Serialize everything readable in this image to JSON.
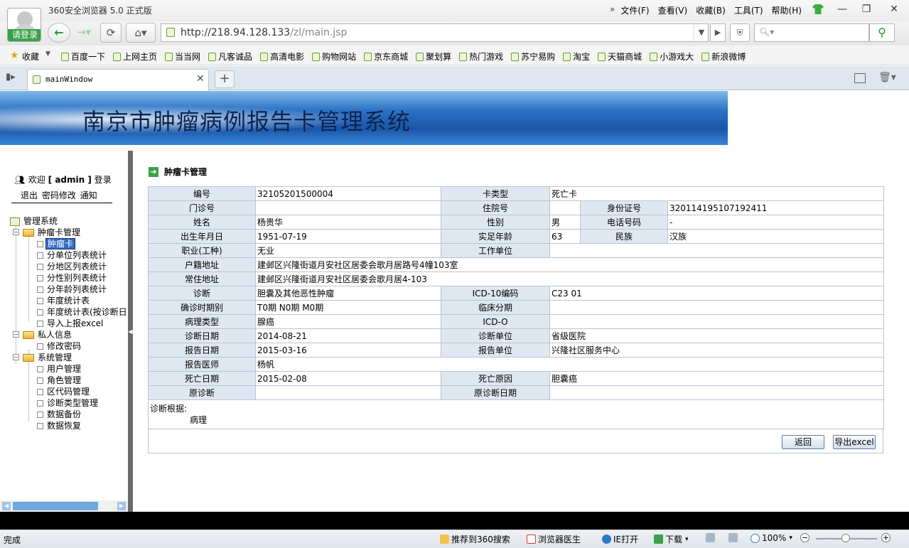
{
  "browser": {
    "title": "360安全浏览器 5.0 正式版",
    "login_label": "请登录",
    "menu": [
      "文件(F)",
      "查看(V)",
      "收藏(B)",
      "工具(T)",
      "帮助(H)"
    ],
    "url_host": "http://218.94.128.133",
    "url_path": "/zl/main.jsp",
    "search_placeholder": "",
    "favorites_label": "收藏",
    "favorites": [
      "百度一下",
      "上网主页",
      "当当网",
      "凡客诚品",
      "高清电影",
      "购物网站",
      "京东商城",
      "聚划算",
      "热门游戏",
      "苏宁易购",
      "淘宝",
      "天猫商城",
      "小游戏大",
      "新浪微博"
    ],
    "tab_label": "mainWindow"
  },
  "page": {
    "banner_title": "南京市肿瘤病例报告卡管理系统",
    "welcome_prefix": "欢迎",
    "welcome_user": "[ admin ]",
    "welcome_suffix": "登录",
    "user_links": [
      "退出",
      "密码修改",
      "通知"
    ],
    "tree": {
      "root": "管理系统",
      "groups": [
        {
          "label": "肿瘤卡管理",
          "items": [
            "肿瘤卡",
            "分单位列表统计",
            "分地区列表统计",
            "分性别列表统计",
            "分年龄列表统计",
            "年度统计表",
            "年度统计表(按诊断日",
            "导入上报excel"
          ]
        },
        {
          "label": "私人信息",
          "items": [
            "修改密码"
          ]
        },
        {
          "label": "系统管理",
          "items": [
            "用户管理",
            "角色管理",
            "区代码管理",
            "诊断类型管理",
            "数据备份",
            "数据恢复"
          ]
        }
      ]
    },
    "section_title": "肿瘤卡管理",
    "card": {
      "l_no": "编号",
      "v_no": "32105201500004",
      "l_cardtype": "卡类型",
      "v_cardtype": "死亡卡",
      "l_outpatient": "门诊号",
      "v_outpatient": "",
      "l_inpatient": "住院号",
      "v_inpatient": "",
      "l_idno": "身份证号",
      "v_idno": "320114195107192411",
      "l_name": "姓名",
      "v_name": "杨贵华",
      "l_sex": "性别",
      "v_sex": "男",
      "l_phone": "电话号码",
      "v_phone": "-",
      "l_birth": "出生年月日",
      "v_birth": "1951-07-19",
      "l_age": "实足年龄",
      "v_age": "63",
      "l_ethnic": "民族",
      "v_ethnic": "汉族",
      "l_job": "职业(工种)",
      "v_job": "无业",
      "l_workunit": "工作单位",
      "v_workunit": "",
      "l_hukou": "户籍地址",
      "v_hukou": "建邺区兴隆街道月安社区居委会歌月居路号4幢103室",
      "l_resid": "常住地址",
      "v_resid": "建邺区兴隆街道月安社区居委会歌月居4-103",
      "l_diag": "诊断",
      "v_diag": "胆囊及其他恶性肿瘤",
      "l_icd10": "ICD-10编码",
      "v_icd10": "C23 01",
      "l_stage": "确诊时期别",
      "v_stage": "T0期  N0期  M0期",
      "l_clinstage": "临床分期",
      "v_clinstage": "",
      "l_pathtype": "病理类型",
      "v_pathtype": "腺癌",
      "l_icdo": "ICD-O",
      "v_icdo": "",
      "l_diagdate": "诊断日期",
      "v_diagdate": "2014-08-21",
      "l_diagunit": "诊断单位",
      "v_diagunit": "省级医院",
      "l_repdate": "报告日期",
      "v_repdate": "2015-03-16",
      "l_repunit": "报告单位",
      "v_repunit": "兴隆社区服务中心",
      "l_doctor": "报告医师",
      "v_doctor": "杨帆",
      "l_deathdate": "死亡日期",
      "v_deathdate": "2015-02-08",
      "l_deathcause": "死亡原因",
      "v_deathcause": "胆囊癌",
      "l_origdiag": "原诊断",
      "v_origdiag": "",
      "l_origdate": "原诊断日期",
      "v_origdate": "",
      "l_basis": "诊断根据:",
      "v_basis": "病理"
    },
    "buttons": {
      "back": "返回",
      "export": "导出excel"
    }
  },
  "statusbar": {
    "status": "完成",
    "recommend": "推荐到360搜索",
    "doctor": "浏览器医生",
    "ie_open": "IE打开",
    "download": "下载",
    "zoom": "100%"
  },
  "colors": {
    "label_bg": "#dfe7f1",
    "border": "#b8c4d4",
    "banner": "#2d74c6",
    "selected": "#316ac5",
    "accent_green": "#3aa14a"
  }
}
